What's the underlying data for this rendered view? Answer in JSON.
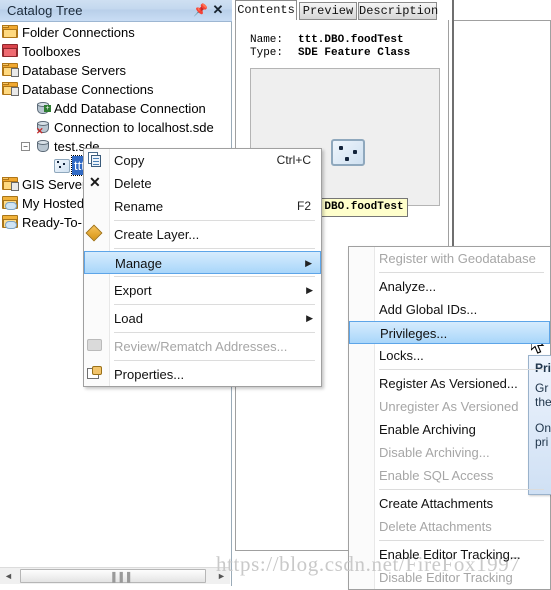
{
  "catalog": {
    "title": "Catalog Tree",
    "pin_icon": "pin-icon",
    "close_icon": "close-icon",
    "tree": [
      {
        "label": "Folder Connections",
        "indent": 0,
        "icon": "folder-icon",
        "expander": "none"
      },
      {
        "label": "Toolboxes",
        "indent": 0,
        "icon": "toolbox-icon",
        "expander": "none"
      },
      {
        "label": "Database Servers",
        "indent": 0,
        "icon": "database-server-icon",
        "expander": "none"
      },
      {
        "label": "Database Connections",
        "indent": 0,
        "icon": "database-connections-icon",
        "expander": "none"
      },
      {
        "label": "Add Database Connection",
        "indent": 1,
        "icon": "add-database-icon",
        "expander": "none"
      },
      {
        "label": "Connection to localhost.sde",
        "indent": 1,
        "icon": "database-broken-icon",
        "expander": "none"
      },
      {
        "label": "test.sde",
        "indent": 1,
        "icon": "database-icon",
        "expander": "minus"
      },
      {
        "label": "ttt.DBO.foodTest",
        "indent": 2,
        "icon": "point-feature-icon",
        "expander": "none",
        "selected": true
      },
      {
        "label": "GIS Servers",
        "indent": 0,
        "icon": "gis-servers-icon",
        "expander": "none"
      },
      {
        "label": "My Hosted Services",
        "indent": 0,
        "icon": "cloud-folder-icon",
        "expander": "none"
      },
      {
        "label": "Ready-To-Use Services",
        "indent": 0,
        "icon": "cloud-folder-icon",
        "expander": "none"
      }
    ],
    "hscroll": {
      "left_arrow": "◄",
      "right_arrow": "►",
      "grip": "▐▐▐"
    }
  },
  "content": {
    "tabs": [
      {
        "label": "Contents",
        "active": true
      },
      {
        "label": "Preview",
        "active": false
      },
      {
        "label": "Description",
        "active": false
      }
    ],
    "name_label": "Name:",
    "name_value": "ttt.DBO.foodTest",
    "type_label": "Type:",
    "type_value": "SDE Feature Class",
    "item_caption": "ttt.DBO.foodTest",
    "feature_icon": "point-feature-class-icon"
  },
  "context_menu": {
    "items": [
      {
        "label": "Copy",
        "accel": "Ctrl+C",
        "icon": "copy-icon",
        "state": "normal",
        "submenu": false
      },
      {
        "label": "Delete",
        "accel": "",
        "icon": "delete-x-icon",
        "state": "normal",
        "submenu": false
      },
      {
        "label": "Rename",
        "accel": "F2",
        "icon": "",
        "state": "normal",
        "submenu": false
      },
      {
        "separator": true
      },
      {
        "label": "Create Layer...",
        "accel": "",
        "icon": "create-layer-icon",
        "state": "normal",
        "submenu": false
      },
      {
        "separator": true
      },
      {
        "label": "Manage",
        "accel": "",
        "icon": "",
        "state": "highlighted",
        "submenu": true
      },
      {
        "separator": true
      },
      {
        "label": "Export",
        "accel": "",
        "icon": "",
        "state": "normal",
        "submenu": true
      },
      {
        "separator": true
      },
      {
        "label": "Load",
        "accel": "",
        "icon": "",
        "state": "normal",
        "submenu": true
      },
      {
        "separator": true
      },
      {
        "label": "Review/Rematch Addresses...",
        "accel": "",
        "icon": "review-addresses-icon",
        "state": "disabled",
        "submenu": false
      },
      {
        "separator": true
      },
      {
        "label": "Properties...",
        "accel": "",
        "icon": "properties-icon",
        "state": "normal",
        "submenu": false
      }
    ]
  },
  "sub_menu": {
    "items": [
      {
        "label": "Register with Geodatabase",
        "state": "disabled"
      },
      {
        "separator": true
      },
      {
        "label": "Analyze...",
        "state": "normal"
      },
      {
        "label": "Add Global IDs...",
        "state": "normal"
      },
      {
        "label": "Privileges...",
        "state": "highlighted"
      },
      {
        "label": "Locks...",
        "state": "normal"
      },
      {
        "separator": true
      },
      {
        "label": "Register As Versioned...",
        "state": "normal"
      },
      {
        "label": "Unregister As Versioned",
        "state": "disabled"
      },
      {
        "label": "Enable Archiving",
        "state": "normal"
      },
      {
        "label": "Disable Archiving...",
        "state": "disabled"
      },
      {
        "label": "Enable SQL Access",
        "state": "disabled"
      },
      {
        "separator": true
      },
      {
        "label": "Create Attachments",
        "state": "normal"
      },
      {
        "label": "Delete Attachments",
        "state": "disabled"
      },
      {
        "separator": true
      },
      {
        "label": "Enable Editor Tracking...",
        "state": "normal"
      },
      {
        "label": "Disable Editor Tracking",
        "state": "disabled"
      }
    ]
  },
  "tooltip": {
    "title": "Priv",
    "body1": "Gr\nthe",
    "body2": "On\npri"
  },
  "watermark": {
    "text": "https://blog.csdn.net/FireFox1997"
  },
  "colors": {
    "titlebar": "#c3d7ee",
    "selection": "#316ac5",
    "menu_highlight": "#a9d6fa",
    "caption_bg": "#ffffcc",
    "tooltip_bg": "#cfe0f4"
  }
}
